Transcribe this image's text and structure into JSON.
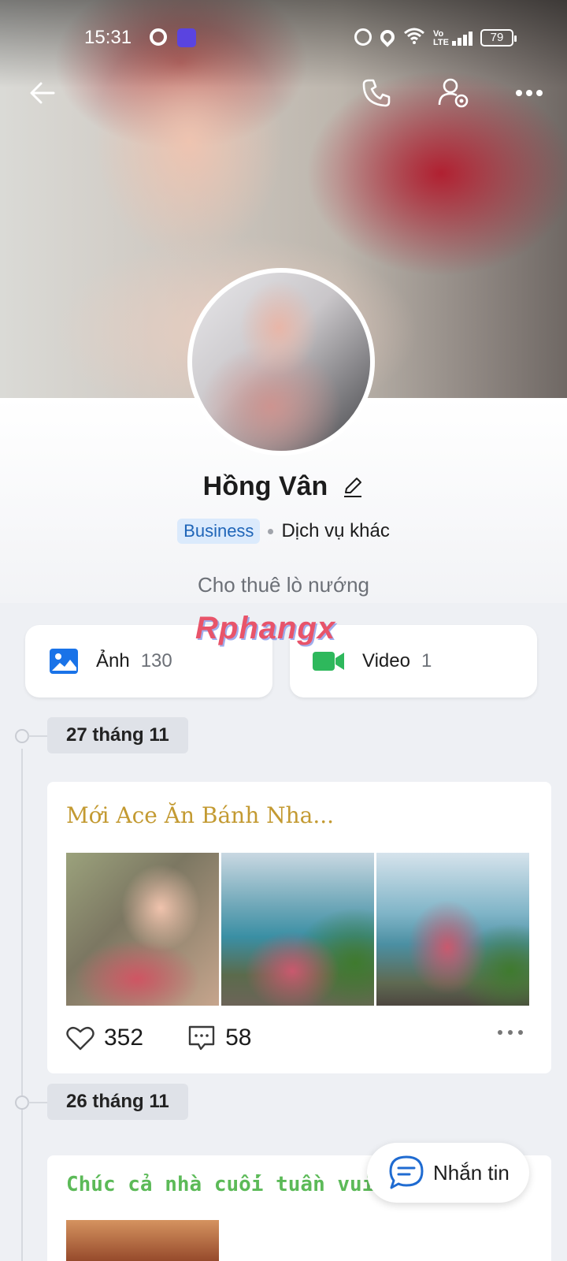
{
  "status_bar": {
    "time": "15:31",
    "network": "Vo LTE",
    "battery": "79"
  },
  "nav": {
    "back_icon": "arrow-left-icon",
    "call_icon": "phone-icon",
    "settings_icon": "user-settings-icon",
    "more_icon": "more-horizontal-icon"
  },
  "profile": {
    "name": "Hồng Vân",
    "badge": "Business",
    "category": "Dịch vụ khác",
    "bio": "Cho thuê lò nướng"
  },
  "watermark": "Rphangx",
  "media": {
    "photos": {
      "label": "Ảnh",
      "count": "130",
      "color": "#1a73e8"
    },
    "videos": {
      "label": "Video",
      "count": "1",
      "color": "#2eb85c"
    }
  },
  "posts": [
    {
      "date": "27 tháng 11",
      "title": "Mới Ace Ăn Bánh Nha...",
      "likes": "352",
      "comments": "58"
    },
    {
      "date": "26 tháng 11",
      "title": "Chúc cả nhà cuối tuần vui"
    }
  ],
  "fab": {
    "label": "Nhắn tin",
    "icon": "chat-bubble-icon",
    "accent": "#1f6bd1"
  }
}
